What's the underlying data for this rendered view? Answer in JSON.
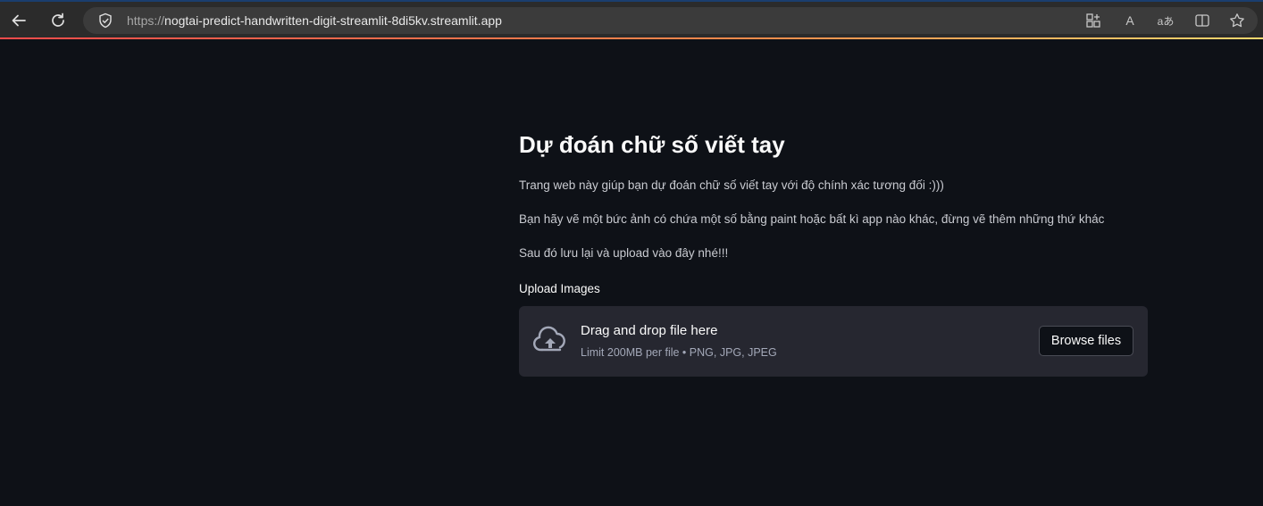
{
  "browser": {
    "url_protocol": "https://",
    "url_host": "nogtai-predict-handwritten-digit-streamlit-8di5kv.streamlit.app",
    "icons": [
      "back-icon",
      "refresh-icon",
      "shield-icon",
      "apps-icon",
      "read-aloud-icon",
      "translate-icon",
      "split-screen-icon",
      "favorite-star-icon"
    ],
    "read_aloud_glyph": "A",
    "translate_glyph": "aあ"
  },
  "page": {
    "title": "Dự đoán chữ số viết tay",
    "paragraphs": [
      "Trang web này giúp bạn dự đoán chữ số viết tay với độ chính xác tương đối :)))",
      "Bạn hãy vẽ một bức ảnh có chứa một số bằng paint hoặc bất kì app nào khác, đừng vẽ thêm những thứ khác",
      "Sau đó lưu lại và upload vào đây nhé!!!"
    ],
    "uploader": {
      "label": "Upload Images",
      "drop_text": "Drag and drop file here",
      "limit_text": "Limit 200MB per file • PNG, JPG, JPEG",
      "browse_label": "Browse files"
    }
  },
  "colors": {
    "background": "#0e1117",
    "dropzone": "#262730",
    "accent_gradient": [
      "#ff4b4b",
      "#ffd86e"
    ]
  }
}
